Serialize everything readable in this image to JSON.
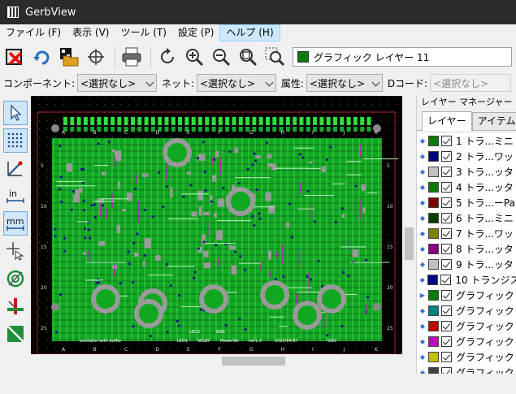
{
  "window": {
    "title": "GerbView"
  },
  "menu": [
    {
      "label": "ファイル (F)"
    },
    {
      "label": "表示 (V)"
    },
    {
      "label": "ツール (T)"
    },
    {
      "label": "設定 (P)"
    },
    {
      "label": "ヘルプ (H)"
    }
  ],
  "toolbar": {
    "icons": [
      "clear-board-icon",
      "reload-icon",
      "open-folder-icon",
      "target-icon",
      "print-icon",
      "redraw-icon",
      "zoom-in-icon",
      "zoom-out-icon",
      "zoom-fit-icon",
      "zoom-selection-icon"
    ],
    "active_layer": "グラフィック レイヤー 11",
    "active_layer_color": "#0b7a0b"
  },
  "filters": {
    "component_label": "コンポーネント:",
    "component_value": "<選択なし>",
    "net_label": "ネット:",
    "net_value": "<選択なし>",
    "attribute_label": "属性:",
    "attribute_value": "<選択なし>",
    "dcode_label": "Dコード:",
    "dcode_value": "<選択なし>"
  },
  "left_toolbar": [
    "select-arrow-icon",
    "grid-icon",
    "polar-coords-icon",
    "inch-units-icon",
    "mm-units-icon",
    "cursor-icon",
    "no-fill-icon",
    "diff-mode-icon",
    "flash-mode-icon"
  ],
  "layer_manager": {
    "title": "レイヤー マネージャー",
    "tabs": [
      "レイヤー",
      "アイテム"
    ],
    "active_tab": 0,
    "layers": [
      {
        "name": "1 トラ...ミニ",
        "color": "#0b7a0b"
      },
      {
        "name": "2 トラ...ワッ",
        "color": "#000080"
      },
      {
        "name": "3 トラ...ッタ",
        "color": "#c0c0c0"
      },
      {
        "name": "4 トラ...ッタ",
        "color": "#0b7a0b"
      },
      {
        "name": "5 トラ...ーPa",
        "color": "#800000"
      },
      {
        "name": "6 トラ...ミニ",
        "color": "#004000"
      },
      {
        "name": "7 トラ...ワッ",
        "color": "#808000"
      },
      {
        "name": "8 トラ...ッタ",
        "color": "#800080"
      },
      {
        "name": "9 トラ...ッタ",
        "color": "#c0c0c0"
      },
      {
        "name": "10 トランジス",
        "color": "#000080"
      },
      {
        "name": "グラフィック",
        "color": "#0b7a0b"
      },
      {
        "name": "グラフィック",
        "color": "#008080"
      },
      {
        "name": "グラフィック",
        "color": "#c00000"
      },
      {
        "name": "グラフィック",
        "color": "#c000c0"
      },
      {
        "name": "グラフィック",
        "color": "#c0c000"
      },
      {
        "name": "グラフィック",
        "color": "#404040"
      }
    ],
    "current_marker_row": 10
  },
  "board": {
    "columns": [
      "A",
      "B",
      "C",
      "D",
      "E",
      "F",
      "G",
      "H",
      "I",
      "J",
      "K"
    ],
    "rows": [
      "5",
      "10",
      "15",
      "20",
      "25"
    ],
    "silk_texts": [
      "LED1",
      "SELBY",
      "PowerVol",
      "ver1.0",
      "2020/04/07",
      "SW2",
      "LED2",
      "SW1",
      "oscillator with buffer"
    ]
  }
}
